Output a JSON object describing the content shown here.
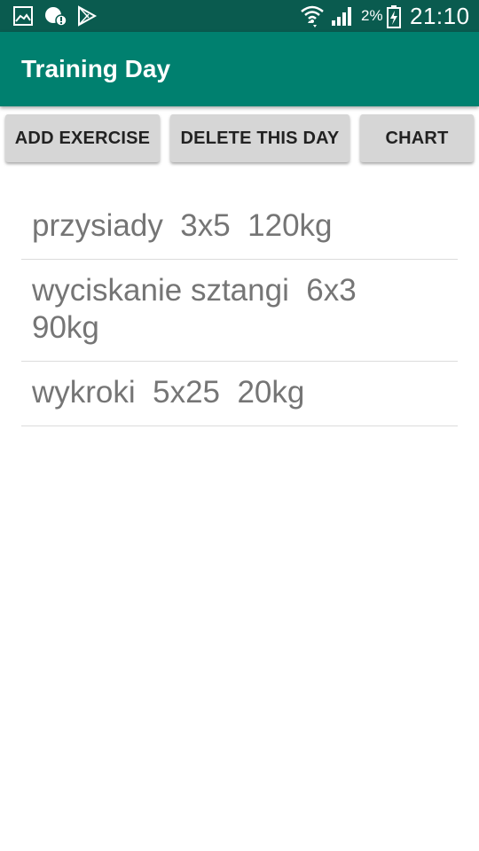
{
  "status_bar": {
    "battery_percent": "2%",
    "time": "21:10",
    "icons": [
      "gallery-icon",
      "notification-alert-icon",
      "play-store-icon",
      "wifi-icon",
      "cell-signal-icon",
      "battery-charging-icon"
    ]
  },
  "app_bar": {
    "title": "Training Day",
    "color": "#00806f"
  },
  "buttons": {
    "add_exercise": "ADD EXERCISE",
    "delete_day": "DELETE THIS DAY",
    "chart": "CHART"
  },
  "exercises": [
    {
      "text": "przysiady  3x5  120kg"
    },
    {
      "text": "wyciskanie sztangi  6x3  90kg"
    },
    {
      "text": "wykroki  5x25  20kg"
    }
  ]
}
